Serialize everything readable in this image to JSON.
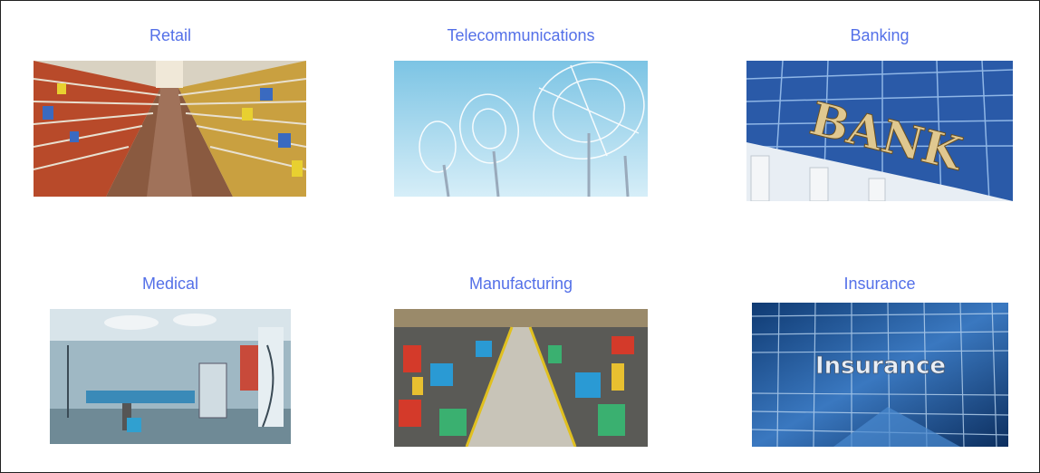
{
  "industries": [
    {
      "label": "Retail",
      "image_alt": "supermarket aisle with stocked shelves"
    },
    {
      "label": "Telecommunications",
      "image_alt": "satellite dish antennas against sky"
    },
    {
      "label": "Banking",
      "image_alt": "BANK sign on building with columns"
    },
    {
      "label": "Medical",
      "image_alt": "hospital operating room"
    },
    {
      "label": "Manufacturing",
      "image_alt": "factory floor with machinery"
    },
    {
      "label": "Insurance",
      "image_alt": "Insurance sign on glass building"
    }
  ],
  "images": {
    "bank_sign_text": "BANK",
    "insurance_sign_text": "Insurance"
  },
  "colors": {
    "label": "#5470e8",
    "border": "#222222"
  }
}
